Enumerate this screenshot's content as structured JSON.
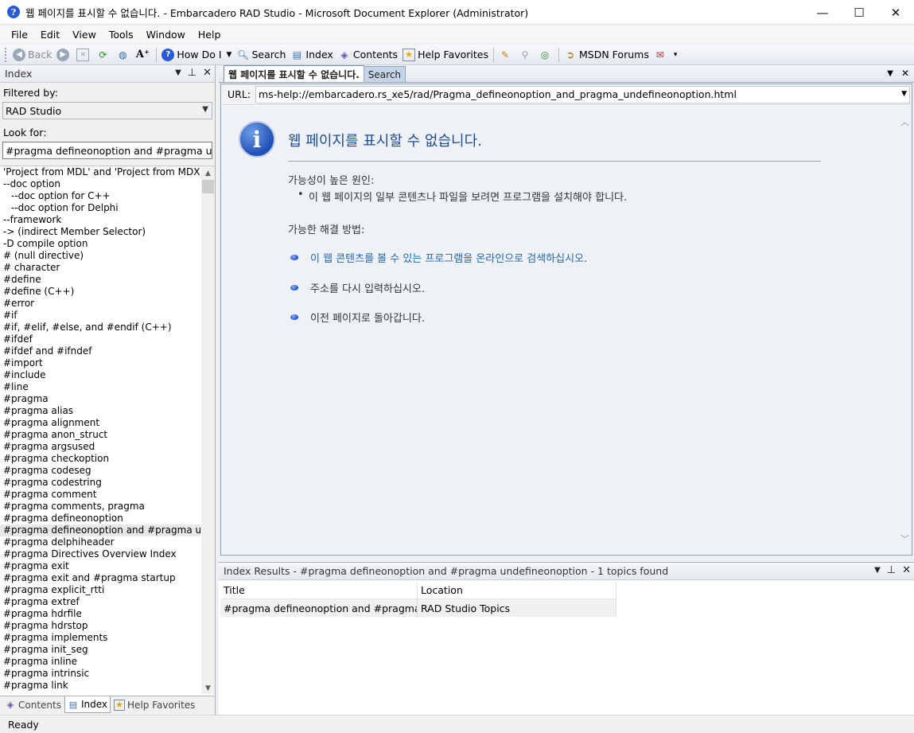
{
  "window": {
    "title": "웹 페이지를 표시할 수 없습니다. - Embarcadero RAD Studio - Microsoft Document Explorer (Administrator)",
    "minimize": "—",
    "maximize": "☐",
    "close": "✕"
  },
  "menu": [
    "File",
    "Edit",
    "View",
    "Tools",
    "Window",
    "Help"
  ],
  "toolbar": {
    "back": "Back",
    "how_do_i": "How Do I",
    "search": "Search",
    "index": "Index",
    "contents": "Contents",
    "help_favorites": "Help Favorites",
    "msdn_forums": "MSDN Forums"
  },
  "left_pane": {
    "title": "Index",
    "filtered_by_label": "Filtered by:",
    "filter_value": "RAD Studio",
    "look_for_label": "Look for:",
    "look_for_value": "#pragma defineonoption and #pragma undefineonoption",
    "items": [
      {
        "text": "'Project from MDL' and 'Project from MDX' Wizards",
        "indent": false,
        "selected": false
      },
      {
        "text": "--doc option",
        "indent": false,
        "selected": false
      },
      {
        "text": "--doc option for C++",
        "indent": true,
        "selected": false
      },
      {
        "text": "--doc option for Delphi",
        "indent": true,
        "selected": false
      },
      {
        "text": "--framework",
        "indent": false,
        "selected": false
      },
      {
        "text": "-> (indirect Member Selector)",
        "indent": false,
        "selected": false
      },
      {
        "text": "-D compile option",
        "indent": false,
        "selected": false
      },
      {
        "text": "# (null directive)",
        "indent": false,
        "selected": false
      },
      {
        "text": "# character",
        "indent": false,
        "selected": false
      },
      {
        "text": "#define",
        "indent": false,
        "selected": false
      },
      {
        "text": "#define (C++)",
        "indent": false,
        "selected": false
      },
      {
        "text": "#error",
        "indent": false,
        "selected": false
      },
      {
        "text": "#if",
        "indent": false,
        "selected": false
      },
      {
        "text": "#if, #elif, #else, and #endif (C++)",
        "indent": false,
        "selected": false
      },
      {
        "text": "#ifdef",
        "indent": false,
        "selected": false
      },
      {
        "text": "#ifdef and #ifndef",
        "indent": false,
        "selected": false
      },
      {
        "text": "#import",
        "indent": false,
        "selected": false
      },
      {
        "text": "#include",
        "indent": false,
        "selected": false
      },
      {
        "text": "#line",
        "indent": false,
        "selected": false
      },
      {
        "text": "#pragma",
        "indent": false,
        "selected": false
      },
      {
        "text": "#pragma alias",
        "indent": false,
        "selected": false
      },
      {
        "text": "#pragma alignment",
        "indent": false,
        "selected": false
      },
      {
        "text": "#pragma anon_struct",
        "indent": false,
        "selected": false
      },
      {
        "text": "#pragma argsused",
        "indent": false,
        "selected": false
      },
      {
        "text": "#pragma checkoption",
        "indent": false,
        "selected": false
      },
      {
        "text": "#pragma codeseg",
        "indent": false,
        "selected": false
      },
      {
        "text": "#pragma codestring",
        "indent": false,
        "selected": false
      },
      {
        "text": "#pragma comment",
        "indent": false,
        "selected": false
      },
      {
        "text": "#pragma comments, pragma",
        "indent": false,
        "selected": false
      },
      {
        "text": "#pragma defineonoption",
        "indent": false,
        "selected": false
      },
      {
        "text": "#pragma defineonoption and #pragma undefineonoption",
        "indent": false,
        "selected": true
      },
      {
        "text": "#pragma delphiheader",
        "indent": false,
        "selected": false
      },
      {
        "text": "#pragma Directives Overview Index",
        "indent": false,
        "selected": false
      },
      {
        "text": "#pragma exit",
        "indent": false,
        "selected": false
      },
      {
        "text": "#pragma exit and #pragma startup",
        "indent": false,
        "selected": false
      },
      {
        "text": "#pragma explicit_rtti",
        "indent": false,
        "selected": false
      },
      {
        "text": "#pragma extref",
        "indent": false,
        "selected": false
      },
      {
        "text": "#pragma hdrfile",
        "indent": false,
        "selected": false
      },
      {
        "text": "#pragma hdrstop",
        "indent": false,
        "selected": false
      },
      {
        "text": "#pragma implements",
        "indent": false,
        "selected": false
      },
      {
        "text": "#pragma init_seg",
        "indent": false,
        "selected": false
      },
      {
        "text": "#pragma inline",
        "indent": false,
        "selected": false
      },
      {
        "text": "#pragma intrinsic",
        "indent": false,
        "selected": false
      },
      {
        "text": "#pragma link",
        "indent": false,
        "selected": false
      }
    ],
    "tabs": [
      {
        "label": "Contents",
        "icon": "contents-icon",
        "active": false
      },
      {
        "label": "Index",
        "icon": "index-icon",
        "active": true
      },
      {
        "label": "Help Favorites",
        "icon": "favorites-icon",
        "active": false
      }
    ]
  },
  "document": {
    "active_tab": "웹 페이지를 표시할 수 없습니다.",
    "search_tab": "Search",
    "url_label": "URL:",
    "url": "ms-help://embarcadero.rs_xe5/rad/Pragma_defineonoption_and_pragma_undefineonoption.html",
    "error_title": "웹 페이지를 표시할 수 없습니다.",
    "likely_causes_label": "가능성이 높은 원인:",
    "cause_1": "이 웹 페이지의 일부 콘텐츠나 파일을 보려면 프로그램을 설치해야 합니다.",
    "solutions_label": "가능한 해결 방법:",
    "solution_1": "이 웹 콘텐츠를 볼 수 있는 프로그램을 온라인으로 검색하십시오.",
    "solution_2": "주소를 다시 입력하십시오.",
    "solution_3": "이전 페이지로 돌아갑니다.",
    "link_color": "#2265b3"
  },
  "results": {
    "title": "Index Results - #pragma defineonoption and #pragma undefineonoption - 1 topics found",
    "col_title": "Title",
    "col_location": "Location",
    "rows": [
      {
        "title": "#pragma defineonoption and #pragma un...",
        "location": "RAD Studio Topics"
      }
    ]
  },
  "status": {
    "text": "Ready"
  }
}
